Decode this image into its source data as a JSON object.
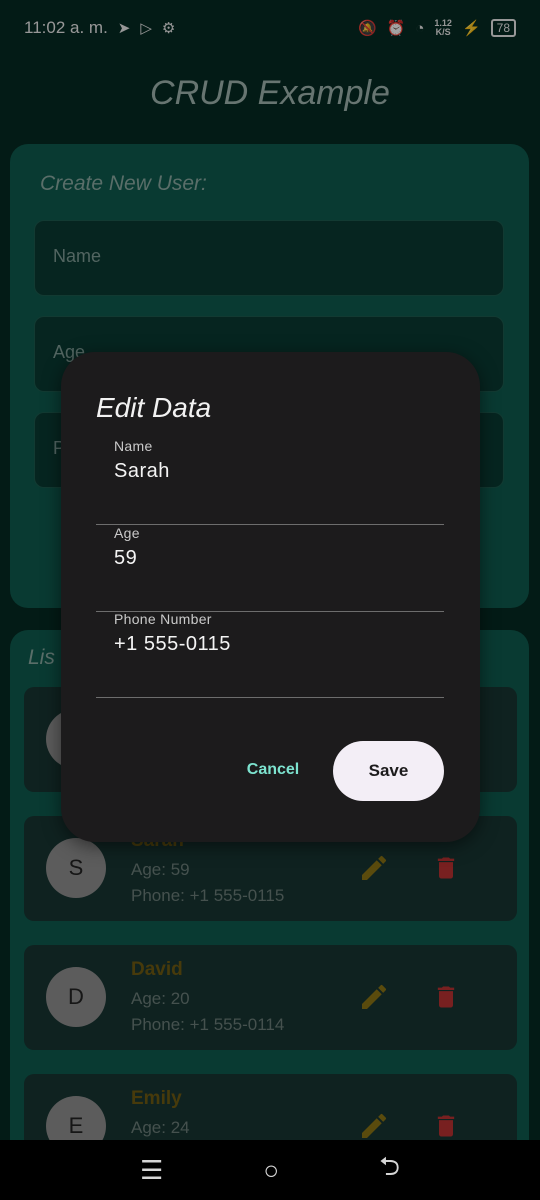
{
  "status_bar": {
    "time": "11:02 a. m.",
    "speed_value": "1.12",
    "speed_unit": "K/S",
    "battery": "78"
  },
  "app": {
    "title": "CRUD Example"
  },
  "create_form": {
    "heading": "Create New User:",
    "name_placeholder": "Name",
    "age_placeholder": "Age",
    "phone_placeholder": "P"
  },
  "list": {
    "heading": "Lis",
    "users": [
      {
        "initial": "S",
        "name": "Sarah",
        "age": "Age: 59",
        "phone": "Phone: +1 555-0115"
      },
      {
        "initial": "D",
        "name": "David",
        "age": "Age: 20",
        "phone": "Phone: +1 555-0114"
      },
      {
        "initial": "E",
        "name": "Emily",
        "age": "Age: 24",
        "phone": ""
      }
    ]
  },
  "dialog": {
    "title": "Edit Data",
    "fields": [
      {
        "label": "Name",
        "value": "Sarah"
      },
      {
        "label": "Age",
        "value": "59"
      },
      {
        "label": "Phone Number",
        "value": "+1 555-0115"
      }
    ],
    "cancel_label": "Cancel",
    "save_label": "Save"
  },
  "nav": {
    "recents": "☰",
    "home": "○",
    "back": "⮌"
  },
  "colors": {
    "accent": "#7de3cf",
    "edit": "#8a7414",
    "delete": "#b83232",
    "card": "#0e5a4d"
  }
}
